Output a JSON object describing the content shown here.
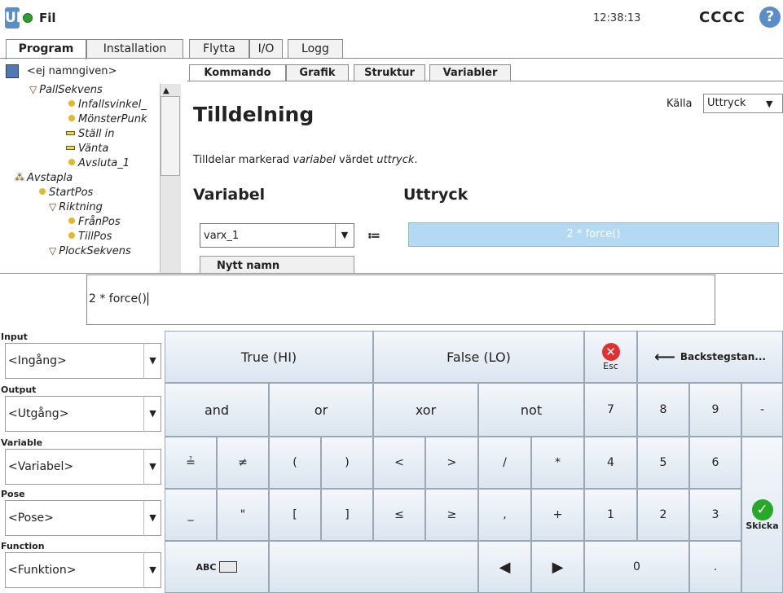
{
  "app": {
    "logo": "UR",
    "file_menu": "Fil",
    "clock": "12:38:13",
    "robot_name": "CCCC",
    "help": "?"
  },
  "top_tabs": [
    "Program",
    "Installation",
    "Flytta",
    "I/O",
    "Logg"
  ],
  "program_name": "<ej namngiven>",
  "tree": [
    {
      "label": "PallSekvens",
      "kind": "tri"
    },
    {
      "label": "Infallsvinkel_",
      "kind": "point"
    },
    {
      "label": "MönsterPunk",
      "kind": "point"
    },
    {
      "label": "Ställ in",
      "kind": "bar"
    },
    {
      "label": "Vänta",
      "kind": "bar"
    },
    {
      "label": "Avsluta_1",
      "kind": "point"
    },
    {
      "label": "Avstapla",
      "kind": "dots"
    },
    {
      "label": "StartPos",
      "kind": "point"
    },
    {
      "label": "Riktning",
      "kind": "tri"
    },
    {
      "label": "FrånPos",
      "kind": "point"
    },
    {
      "label": "TillPos",
      "kind": "point"
    },
    {
      "label": "PlockSekvens",
      "kind": "tri"
    }
  ],
  "sub_tabs": [
    "Kommando",
    "Grafik",
    "Struktur",
    "Variabler"
  ],
  "command": {
    "title": "Tilldelning",
    "source_label": "Källa",
    "source_value": "Uttryck",
    "desc_pre": "Tilldelar markerad ",
    "desc_var": "variabel",
    "desc_mid": " värdet ",
    "desc_expr": "uttryck",
    "desc_end": ".",
    "variable_heading": "Variabel",
    "expression_heading": "Uttryck",
    "variable_value": "varx_1",
    "assign_op": "≔",
    "expression_value": "2 * force()",
    "new_name_button": "Nytt namn"
  },
  "editor": {
    "input_text": "2 * force()",
    "side": [
      {
        "label": "Input",
        "value": "<Ingång>"
      },
      {
        "label": "Output",
        "value": "<Utgång>"
      },
      {
        "label": "Variable",
        "value": "<Variabel>"
      },
      {
        "label": "Pose",
        "value": "<Pose>"
      },
      {
        "label": "Function",
        "value": "<Funktion>"
      }
    ],
    "keys": {
      "true_hi": "True (HI)",
      "false_lo": "False (LO)",
      "esc": "Esc",
      "backspace": "Backstegstan...",
      "and": "and",
      "or": "or",
      "xor": "xor",
      "not": "not",
      "eqq": "≟",
      "neq": "≠",
      "lparen": "(",
      "rparen": ")",
      "lt": "<",
      "gt": ">",
      "div": "/",
      "mul": "*",
      "under": "_",
      "quote": "\"",
      "lbrack": "[",
      "rbrack": "]",
      "le": "≤",
      "ge": "≥",
      "comma": ",",
      "plus": "+",
      "abc": "ABC",
      "left": "◀",
      "right": "▶",
      "n7": "7",
      "n8": "8",
      "n9": "9",
      "minus": "-",
      "n4": "4",
      "n5": "5",
      "n6": "6",
      "n1": "1",
      "n2": "2",
      "n3": "3",
      "n0": "0",
      "dot": ".",
      "send": "Skicka"
    }
  }
}
